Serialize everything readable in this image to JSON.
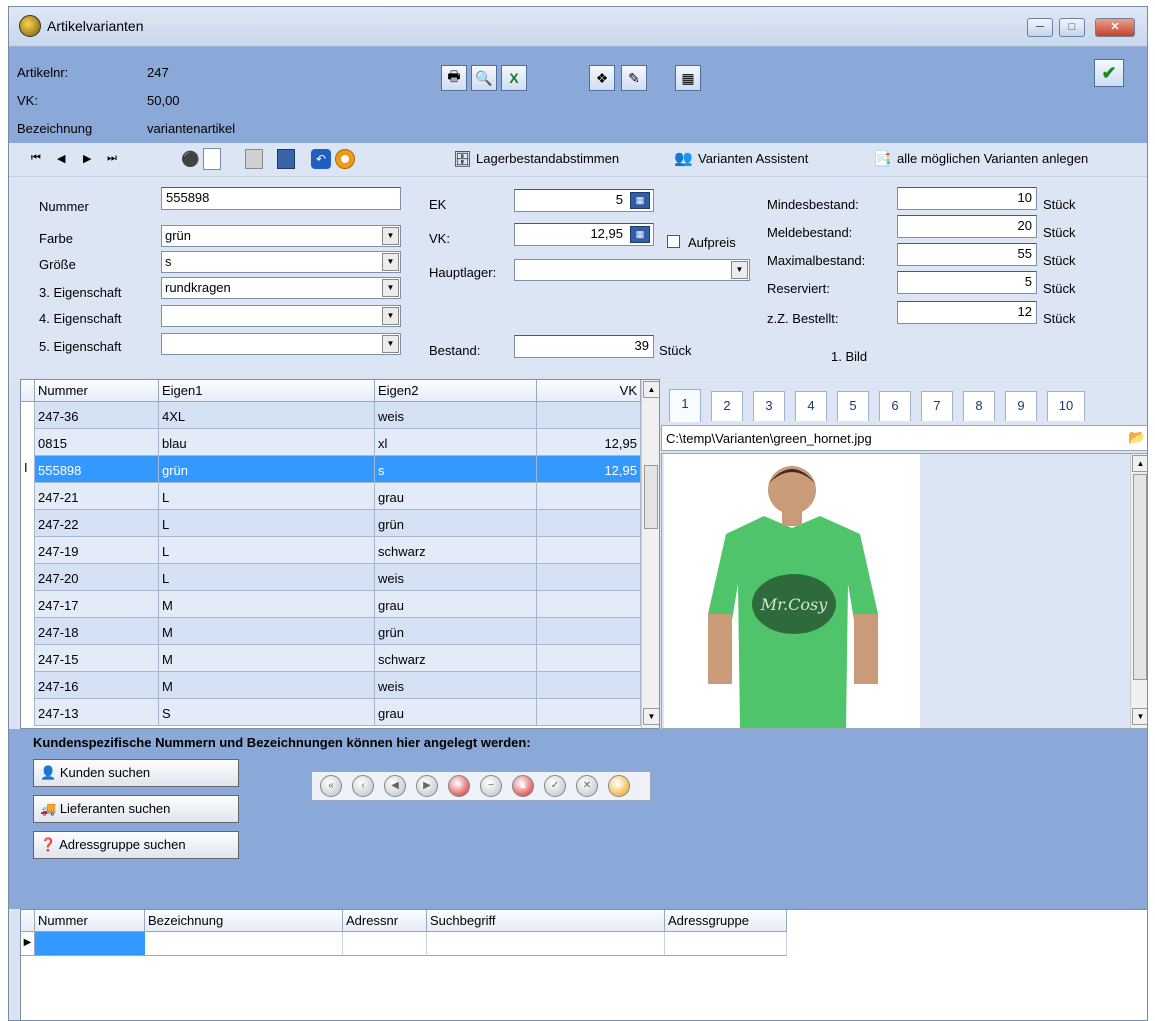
{
  "window": {
    "title": "Artikelvarianten"
  },
  "header": {
    "artikelnr_label": "Artikelnr:",
    "artikelnr": "247",
    "vk_label": "VK:",
    "vk": "50,00",
    "bezeichnung_label": "Bezeichnung",
    "bezeichnung": "variantenartikel"
  },
  "toolbar": {
    "lager": "Lagerbestandabstimmen",
    "assistent": "Varianten Assistent",
    "alle": "alle möglichen Varianten anlegen"
  },
  "form": {
    "nummer_label": "Nummer",
    "nummer": "555898",
    "farbe_label": "Farbe",
    "farbe": "grün",
    "groesse_label": "Größe",
    "groesse": "s",
    "eig3_label": "3. Eigenschaft",
    "eig3": "rundkragen",
    "eig4_label": "4. Eigenschaft",
    "eig4": "",
    "eig5_label": "5. Eigenschaft",
    "eig5": "",
    "ek_label": "EK",
    "ek": "5",
    "vk_label": "VK:",
    "vk": "12,95",
    "aufpreis_label": "Aufpreis",
    "hauptlager_label": "Hauptlager:",
    "hauptlager": "",
    "bestand_label": "Bestand:",
    "bestand": "39",
    "bestand_unit": "Stück",
    "mindest_label": "Mindesbestand:",
    "mindest": "10",
    "melde_label": "Meldebestand:",
    "melde": "20",
    "maximal_label": "Maximalbestand:",
    "maximal": "55",
    "reserviert_label": "Reserviert:",
    "reserviert": "5",
    "bestellt_label": "z.Z. Bestellt:",
    "bestellt": "12",
    "unit": "Stück",
    "bild_label": "1. Bild"
  },
  "grid": {
    "headers": [
      "Nummer",
      "Eigen1",
      "Eigen2",
      "VK"
    ],
    "rows": [
      [
        "247-36",
        "4XL",
        "weis",
        ""
      ],
      [
        "0815",
        "blau",
        "xl",
        "12,95"
      ],
      [
        "555898",
        "grün",
        "s",
        "12,95"
      ],
      [
        "247-21",
        "L",
        "grau",
        ""
      ],
      [
        "247-22",
        "L",
        "grün",
        ""
      ],
      [
        "247-19",
        "L",
        "schwarz",
        ""
      ],
      [
        "247-20",
        "L",
        "weis",
        ""
      ],
      [
        "247-17",
        "M",
        "grau",
        ""
      ],
      [
        "247-18",
        "M",
        "grün",
        ""
      ],
      [
        "247-15",
        "M",
        "schwarz",
        ""
      ],
      [
        "247-16",
        "M",
        "weis",
        ""
      ],
      [
        "247-13",
        "S",
        "grau",
        ""
      ]
    ],
    "selected_row": 2
  },
  "image_panel": {
    "tabs": [
      "1",
      "2",
      "3",
      "4",
      "5",
      "6",
      "7",
      "8",
      "9",
      "10"
    ],
    "active_tab": 0,
    "path": "C:\\temp\\Varianten\\green_hornet.jpg",
    "shirt_print": "Mr.Cosy",
    "shirt_color": "#4fc46a"
  },
  "bottom": {
    "heading": "Kundenspezifische Nummern und Bezeichnungen können hier angelegt werden:",
    "kunden": "Kunden suchen",
    "lieferanten": "Lieferanten suchen",
    "adressgruppe": "Adressgruppe suchen"
  },
  "grid2": {
    "headers": [
      "Nummer",
      "Bezeichnung",
      "Adressnr",
      "Suchbegriff",
      "Adressgruppe"
    ]
  },
  "colors": {
    "accent": "#8aa9d8",
    "selection": "#3399ff"
  }
}
